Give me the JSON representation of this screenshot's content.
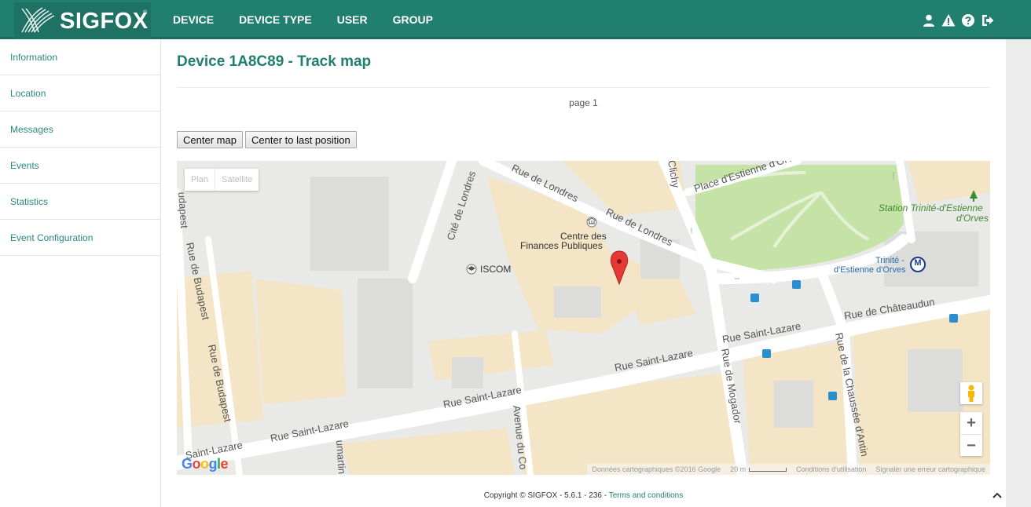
{
  "brand": {
    "name": "SIGFOX",
    "tm": "®"
  },
  "nav": {
    "items": [
      {
        "label": "DEVICE",
        "active": true
      },
      {
        "label": "DEVICE TYPE"
      },
      {
        "label": "USER"
      },
      {
        "label": "GROUP"
      }
    ]
  },
  "top_icons": [
    "user-icon",
    "alert-icon",
    "help-icon",
    "logout-icon"
  ],
  "sidebar": {
    "items": [
      {
        "label": "Information"
      },
      {
        "label": "Location"
      },
      {
        "label": "Messages"
      },
      {
        "label": "Events"
      },
      {
        "label": "Statistics"
      },
      {
        "label": "Event Configuration"
      }
    ]
  },
  "main": {
    "title": "Device 1A8C89 - Track map",
    "page_label": "page 1",
    "center_map_label": "Center map",
    "center_last_label": "Center to last position"
  },
  "map": {
    "type_plan": "Plan",
    "type_satellite": "Satellite",
    "zoom_in": "+",
    "zoom_out": "−",
    "attribution": "Données cartographiques ©2016 Google",
    "scale_label": "20 m",
    "terms": "Conditions d'utilisation",
    "report": "Signaler une erreur cartographique",
    "streets": {
      "rue_de_londres_1": "Rue de Londres",
      "rue_de_londres_2": "Rue de Londres",
      "rue_saint_lazare_1": "Rue Saint-Lazare",
      "rue_saint_lazare_2": "Rue Saint-Lazare",
      "rue_saint_lazare_3": "Rue Saint-Lazare",
      "rue_saint_lazare_4": "Rue Saint-Lazare",
      "rue_saint_lazare_5": "Saint-Lazare",
      "rue_de_budapest_1": "Rue de Budapest",
      "rue_de_budapest_2": "Rue de Budapest",
      "budapest_top": "udapest",
      "rue_de_chateaudun": "Rue de Châteaudun",
      "rue_de_mogador": "Rue de Mogador",
      "rue_chaussee_dantin": "Rue de la Chaussée d'Antin",
      "cite_de_londres": "Cité de Londres",
      "avenue_du_co": "Avenue du Co",
      "place_estienne": "Place d'Estienne d'Orves",
      "clichy": "Clichy",
      "umartin": "umartin"
    },
    "places": {
      "centre_finances_1": "Centre des",
      "centre_finances_2": "Finances Publiques",
      "iscom": "ISCOM",
      "station_1": "Station Trinité-d'Estienne",
      "station_2": "d'Orves",
      "metro_1": "Trinité -",
      "metro_2": "d'Estienne d'Orves"
    },
    "metro_badge": "M"
  },
  "footer": {
    "copyright": "Copyright © SIGFOX - 5.6.1 - 236 - ",
    "terms_link": "Terms and conditions"
  },
  "colors": {
    "primary": "#207f6f",
    "marker": "#e53935",
    "park": "#c5e3a6",
    "building": "#f2e4c6"
  }
}
